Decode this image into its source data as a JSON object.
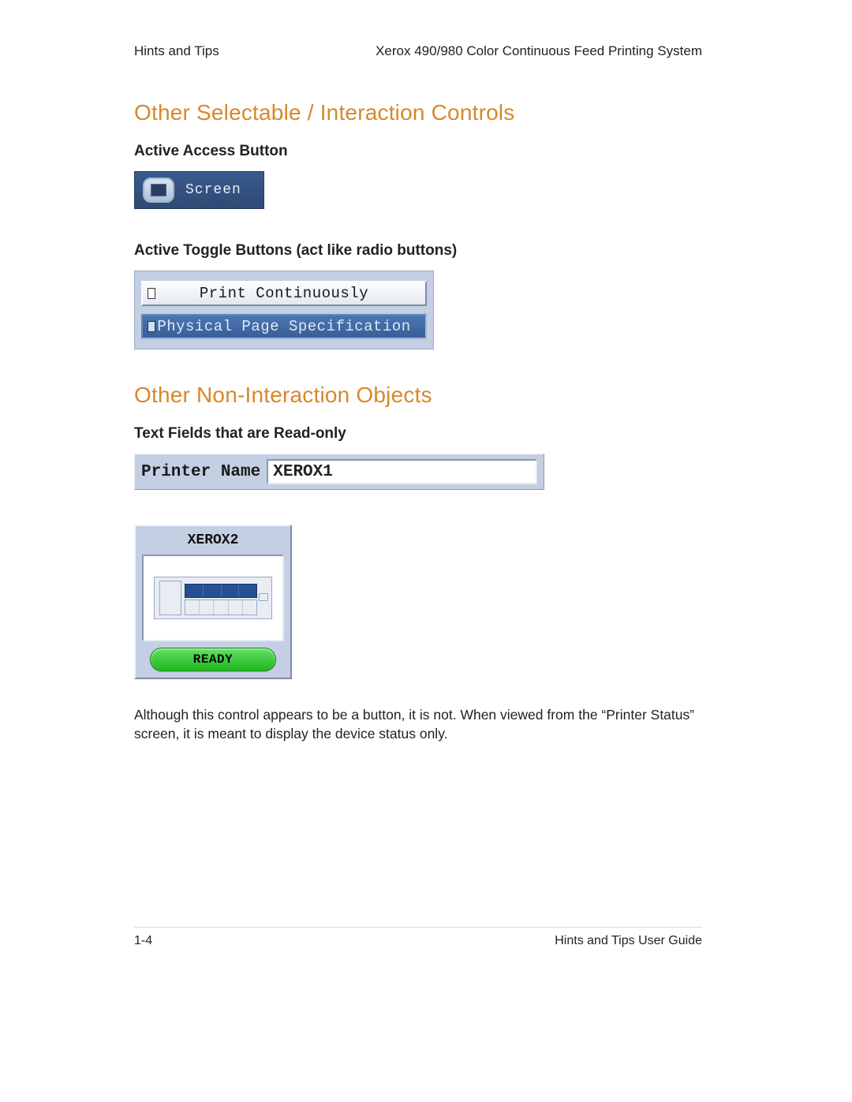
{
  "header": {
    "left": "Hints and Tips",
    "right": "Xerox 490/980 Color Continuous Feed Printing System"
  },
  "sections": {
    "selectable": {
      "title": "Other Selectable / Interaction Controls",
      "access": {
        "heading": "Active Access Button",
        "label": "Screen"
      },
      "toggle": {
        "heading": "Active Toggle Buttons (act like radio buttons)",
        "options": [
          "Print Continuously",
          "Physical Page Specification"
        ]
      }
    },
    "noninteract": {
      "title": "Other Non-Interaction Objects",
      "readonly": {
        "heading": "Text Fields that are Read-only",
        "label": "Printer Name",
        "value": "XEROX1"
      },
      "status": {
        "device_name": "XEROX2",
        "status_text": "READY"
      },
      "note": "Although this control appears to be a button, it is not. When viewed from the “Printer Status” screen, it is meant to display the device status only."
    }
  },
  "footer": {
    "page": "1-4",
    "book": "Hints and Tips User Guide"
  }
}
